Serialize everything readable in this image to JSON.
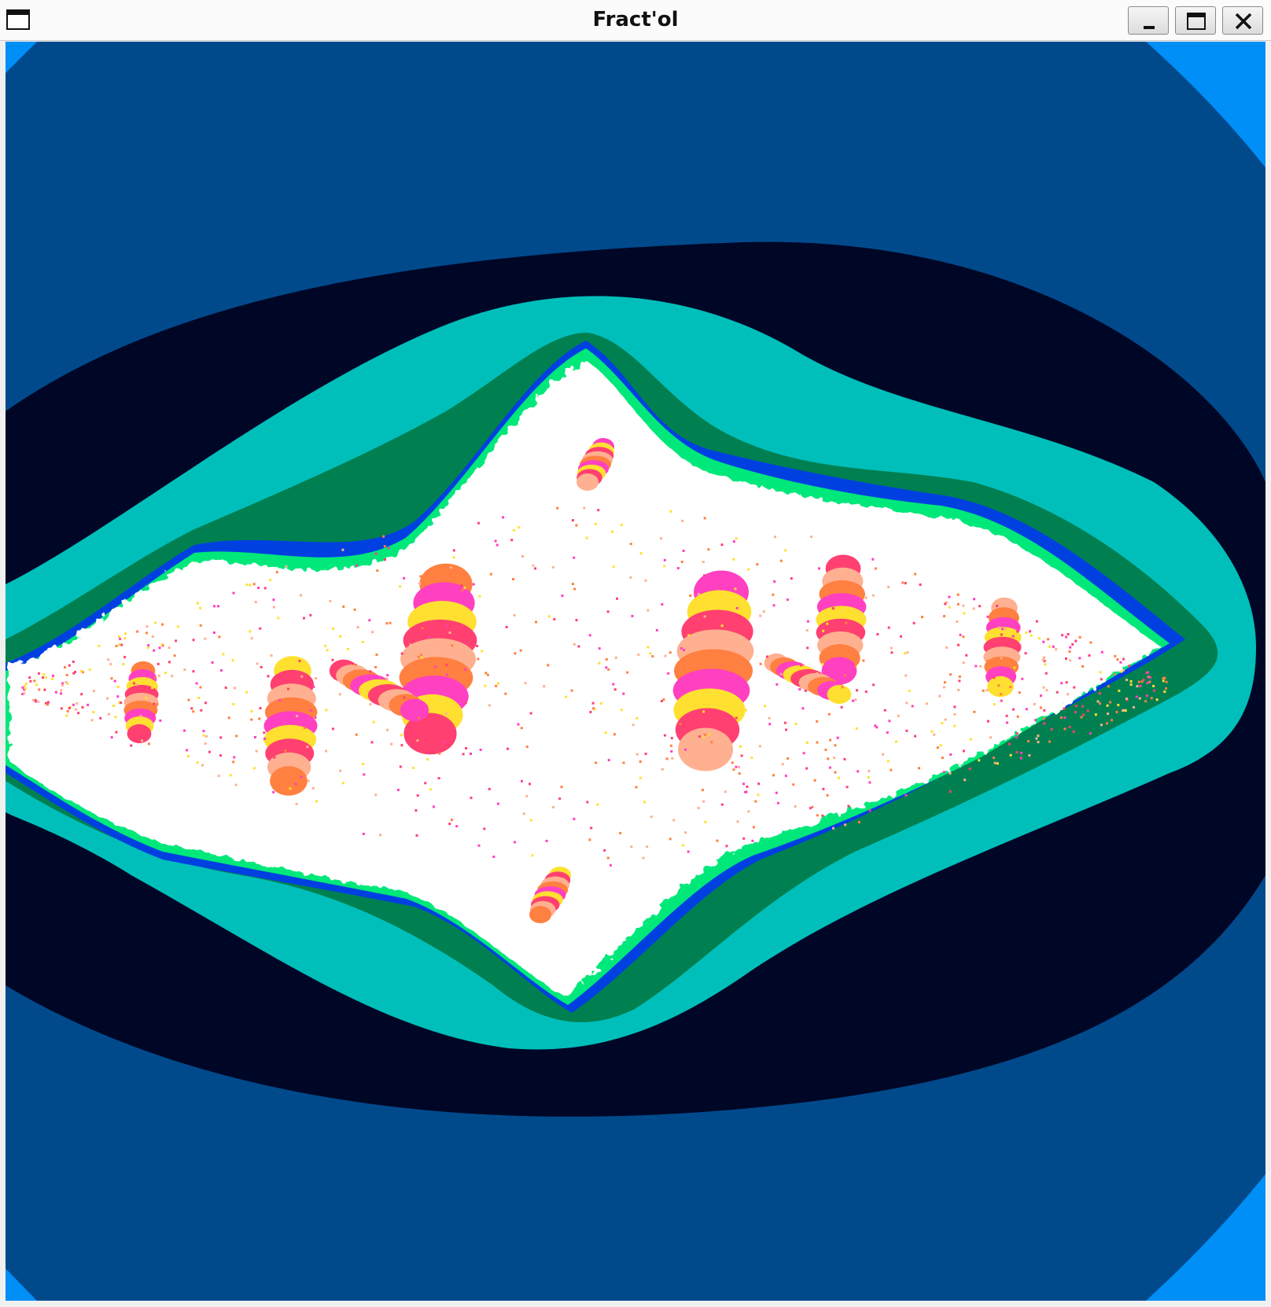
{
  "window": {
    "title": "Fract'ol",
    "controls": {
      "minimize_icon": "minimize-icon",
      "maximize_icon": "maximize-icon",
      "close_icon": "close-icon"
    }
  },
  "fractal": {
    "type": "julia",
    "palette": {
      "background": "#004a8c",
      "corner": "#008ef7",
      "outer_band": "#000726",
      "teal_band": "#00bfbb",
      "green_band": "#008050",
      "blue_band": "#0040e0",
      "lime_band": "#00e87a",
      "inner_set": "#ffffff",
      "swirl_colors": [
        "#ff8040",
        "#ff40c0",
        "#ffe030",
        "#ff4070",
        "#ffb090"
      ]
    }
  }
}
